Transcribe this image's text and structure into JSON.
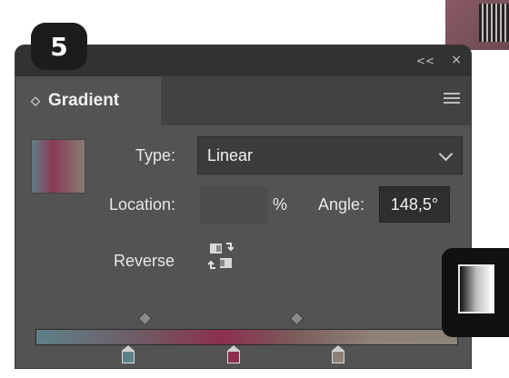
{
  "step": {
    "number": "5"
  },
  "panel": {
    "collapse_glyph": "<<",
    "close_glyph": "×",
    "tab_label": "Gradient",
    "type_label": "Type:",
    "type_value": "Linear",
    "location_label": "Location:",
    "location_value": "",
    "percent_label": "%",
    "angle_label": "Angle:",
    "angle_value": "148,5°",
    "reverse_label": "Reverse"
  },
  "gradient": {
    "stops": [
      {
        "position": 0.22,
        "color": "#5e8088"
      },
      {
        "position": 0.47,
        "color": "#8c2f4f"
      },
      {
        "position": 0.72,
        "color": "#8e8178"
      }
    ],
    "midpoints": [
      0.26,
      0.62
    ]
  },
  "colors": {
    "panel_bg": "#535353",
    "field_dark": "#3c3c3c"
  }
}
